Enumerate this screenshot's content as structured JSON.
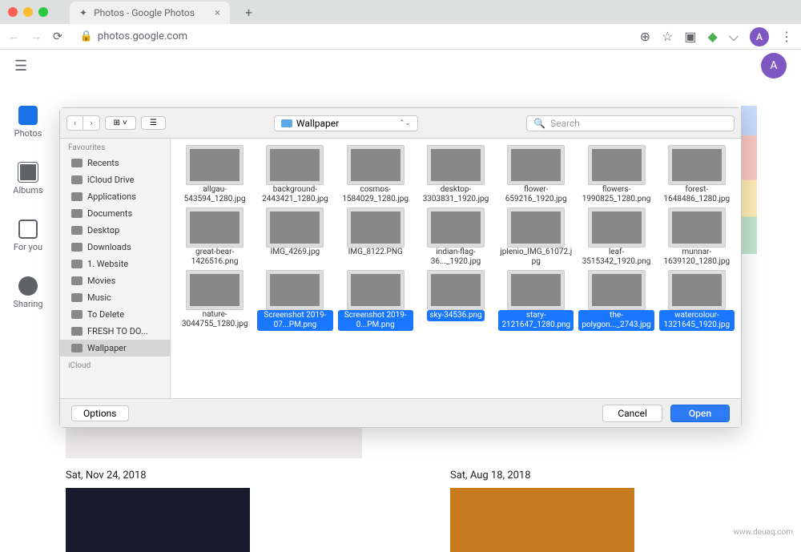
{
  "browser": {
    "tab_title": "Photos - Google Photos",
    "url": "photos.google.com",
    "avatar_initial": "A"
  },
  "app": {
    "avatar_initial": "A",
    "sidebar": [
      {
        "label": "Photos"
      },
      {
        "label": "Albums"
      },
      {
        "label": "For you"
      },
      {
        "label": "Sharing"
      }
    ],
    "dates": {
      "d1": "Sat, Nov 24, 2018",
      "d2": "Sat, Aug 18, 2018"
    }
  },
  "dialog": {
    "location": "Wallpaper",
    "search_placeholder": "Search",
    "sidebar": {
      "header1": "Favourites",
      "items": [
        "Recents",
        "iCloud Drive",
        "Applications",
        "Documents",
        "Desktop",
        "Downloads",
        "1. Website",
        "Movies",
        "Music",
        "To Delete",
        "FRESH TO DO...",
        "Wallpaper"
      ],
      "header2": "iCloud"
    },
    "files": [
      {
        "n": "allgau-543594_1280.jpg",
        "sel": false,
        "c": "c-sky"
      },
      {
        "n": "background-2443421_1280.jpg",
        "sel": false,
        "c": "c-abs"
      },
      {
        "n": "cosmos-1584029_1280.jpg",
        "sel": false,
        "c": "c-dark"
      },
      {
        "n": "desktop-3303831_1920.jpg",
        "sel": false,
        "c": "c-white"
      },
      {
        "n": "flower-659216_1920.jpg",
        "sel": false,
        "c": "c-bw"
      },
      {
        "n": "flowers-1990825_1280.png",
        "sel": false,
        "c": "c-dark"
      },
      {
        "n": "forest-1648486_1280.jpg",
        "sel": false,
        "c": "c-white"
      },
      {
        "n": "great-bear-1426516.png",
        "sel": false,
        "c": "c-dark"
      },
      {
        "n": "IMG_4269.jpg",
        "sel": false,
        "c": "c-green"
      },
      {
        "n": "IMG_8122.PNG",
        "sel": false,
        "c": "c-flag"
      },
      {
        "n": "indian-flag-36..._1920.jpg",
        "sel": false,
        "c": "c-flag"
      },
      {
        "n": "jplenio_IMG_61072.jpg",
        "sel": false,
        "c": "c-green"
      },
      {
        "n": "leaf-3515342_1920.png",
        "sel": false,
        "c": "c-palm"
      },
      {
        "n": "munnar-1639120_1280.jpg",
        "sel": false,
        "c": "c-blue"
      },
      {
        "n": "nature-3044755_1280.jpg",
        "sel": false,
        "c": "c-pink"
      },
      {
        "n": "Screenshot 2019-07...PM.png",
        "sel": true,
        "c": "c-pine"
      },
      {
        "n": "Screenshot 2019-0...PM.png",
        "sel": true,
        "c": "c-black"
      },
      {
        "n": "sky-34536.png",
        "sel": true,
        "c": "c-blue"
      },
      {
        "n": "stary-2121647_1280.png",
        "sel": true,
        "c": "c-train"
      },
      {
        "n": "the-polygon..._2743.jpg",
        "sel": true,
        "c": "c-white"
      },
      {
        "n": "watercolour-1321645_1920.jpg",
        "sel": true,
        "c": "c-rainbow"
      }
    ],
    "buttons": {
      "options": "Options",
      "cancel": "Cancel",
      "open": "Open"
    }
  },
  "watermark": "www.deuaq.com"
}
